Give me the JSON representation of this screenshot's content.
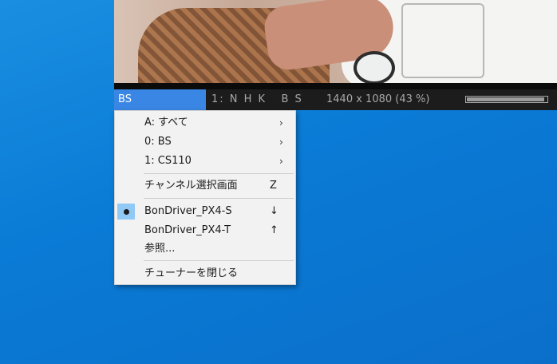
{
  "player": {
    "status_bar": {
      "tuner": "BS",
      "channel": "1: N H K   B S",
      "video_info": "1440 x 1080 (43 %)",
      "signal_level": 0.97
    }
  },
  "context_menu": {
    "items": [
      {
        "label": "A: すべて",
        "arrow": "›"
      },
      {
        "label": "0: BS",
        "arrow": "›"
      },
      {
        "label": "1: CS110",
        "arrow": "›"
      },
      {
        "label": "チャンネル選択画面",
        "accel": "Z"
      },
      {
        "label": "BonDriver_PX4-S",
        "accel": "↓",
        "checked": true
      },
      {
        "label": "BonDriver_PX4-T",
        "accel": "↑"
      },
      {
        "label": "参照..."
      },
      {
        "label": "チューナーを閉じる"
      }
    ]
  },
  "colors": {
    "desktop": "#0a7bd6",
    "status_highlight": "#3a86e4",
    "menu_bg": "#f2f2f2",
    "check_bg": "#90c8f6"
  }
}
